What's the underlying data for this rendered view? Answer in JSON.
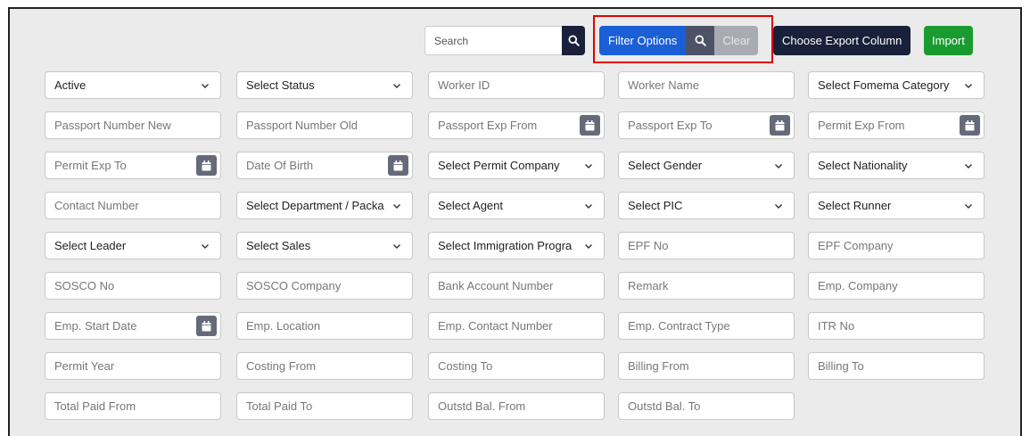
{
  "toolbar": {
    "search_placeholder": "Search",
    "filter_options_label": "Filter Options",
    "clear_label": "Clear",
    "export_label": "Choose Export Column",
    "import_label": "Import"
  },
  "colors": {
    "filter": "#1a5fd6",
    "dark": "#18203a",
    "import": "#1a9b2f",
    "highlight": "#e00000"
  },
  "fields": [
    {
      "type": "select",
      "text": "Active"
    },
    {
      "type": "select",
      "text": "Select Status"
    },
    {
      "type": "input",
      "text": "Worker ID"
    },
    {
      "type": "input",
      "text": "Worker Name"
    },
    {
      "type": "select",
      "text": "Select Fomema Category"
    },
    {
      "type": "input",
      "text": "Passport Number New"
    },
    {
      "type": "input",
      "text": "Passport Number Old"
    },
    {
      "type": "date",
      "text": "Passport Exp From"
    },
    {
      "type": "date",
      "text": "Passport Exp To"
    },
    {
      "type": "date",
      "text": "Permit Exp From"
    },
    {
      "type": "date",
      "text": "Permit Exp To"
    },
    {
      "type": "date",
      "text": "Date Of Birth"
    },
    {
      "type": "select",
      "text": "Select Permit Company"
    },
    {
      "type": "select",
      "text": "Select Gender"
    },
    {
      "type": "select",
      "text": "Select Nationality"
    },
    {
      "type": "input",
      "text": "Contact Number"
    },
    {
      "type": "select",
      "text": "Select Department / Packa"
    },
    {
      "type": "select",
      "text": "Select Agent"
    },
    {
      "type": "select",
      "text": "Select PIC"
    },
    {
      "type": "select",
      "text": "Select Runner"
    },
    {
      "type": "select",
      "text": "Select Leader"
    },
    {
      "type": "select",
      "text": "Select Sales"
    },
    {
      "type": "select",
      "text": "Select Immigration Progra"
    },
    {
      "type": "input",
      "text": "EPF No"
    },
    {
      "type": "input",
      "text": "EPF Company"
    },
    {
      "type": "input",
      "text": "SOSCO No"
    },
    {
      "type": "input",
      "text": "SOSCO Company"
    },
    {
      "type": "input",
      "text": "Bank Account Number"
    },
    {
      "type": "input",
      "text": "Remark"
    },
    {
      "type": "input",
      "text": "Emp. Company"
    },
    {
      "type": "date",
      "text": "Emp. Start Date"
    },
    {
      "type": "input",
      "text": "Emp. Location"
    },
    {
      "type": "input",
      "text": "Emp. Contact Number"
    },
    {
      "type": "input",
      "text": "Emp. Contract Type"
    },
    {
      "type": "input",
      "text": "ITR No"
    },
    {
      "type": "input",
      "text": "Permit Year"
    },
    {
      "type": "input",
      "text": "Costing From"
    },
    {
      "type": "input",
      "text": "Costing To"
    },
    {
      "type": "input",
      "text": "Billing From"
    },
    {
      "type": "input",
      "text": "Billing To"
    },
    {
      "type": "input",
      "text": "Total Paid From"
    },
    {
      "type": "input",
      "text": "Total Paid To"
    },
    {
      "type": "input",
      "text": "Outstd Bal. From"
    },
    {
      "type": "input",
      "text": "Outstd Bal. To"
    }
  ]
}
